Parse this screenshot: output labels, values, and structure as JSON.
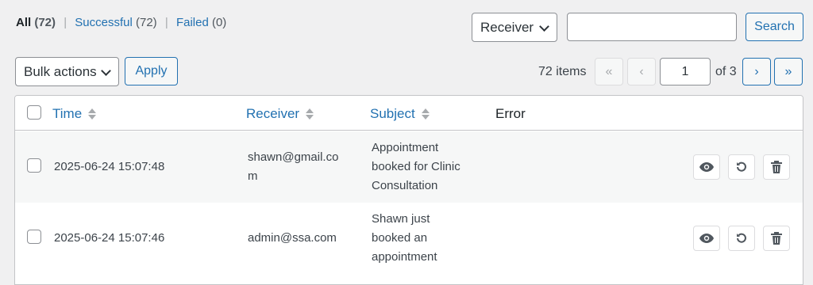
{
  "filters": {
    "all_label": "All",
    "all_count": "(72)",
    "sep": "|",
    "successful_label": "Successful",
    "successful_count": "(72)",
    "failed_label": "Failed",
    "failed_count": "(0)"
  },
  "search": {
    "field_select": "Receiver",
    "query": "",
    "button": "Search"
  },
  "bulk": {
    "select": "Bulk actions",
    "apply": "Apply"
  },
  "pagination": {
    "items": "72 items",
    "first": "«",
    "prev": "‹",
    "current": "1",
    "of": "of 3",
    "next": "›",
    "last": "»"
  },
  "table": {
    "columns": {
      "time": "Time",
      "receiver": "Receiver",
      "subject": "Subject",
      "error": "Error"
    },
    "rows": [
      {
        "time": "2025-06-24 15:07:48",
        "receiver_line1": "shawn@gmail.co",
        "receiver_line2": "m",
        "subject_lines": [
          "Appointment",
          "booked for Clinic",
          "Consultation"
        ],
        "error": ""
      },
      {
        "time": "2025-06-24 15:07:46",
        "receiver_line1": "admin@ssa.com",
        "receiver_line2": "",
        "subject_lines": [
          "Shawn just",
          "booked an",
          "appointment"
        ],
        "error": ""
      }
    ]
  },
  "icons": {
    "view": "eye-icon",
    "resend": "resend-icon",
    "delete": "trash-icon"
  }
}
